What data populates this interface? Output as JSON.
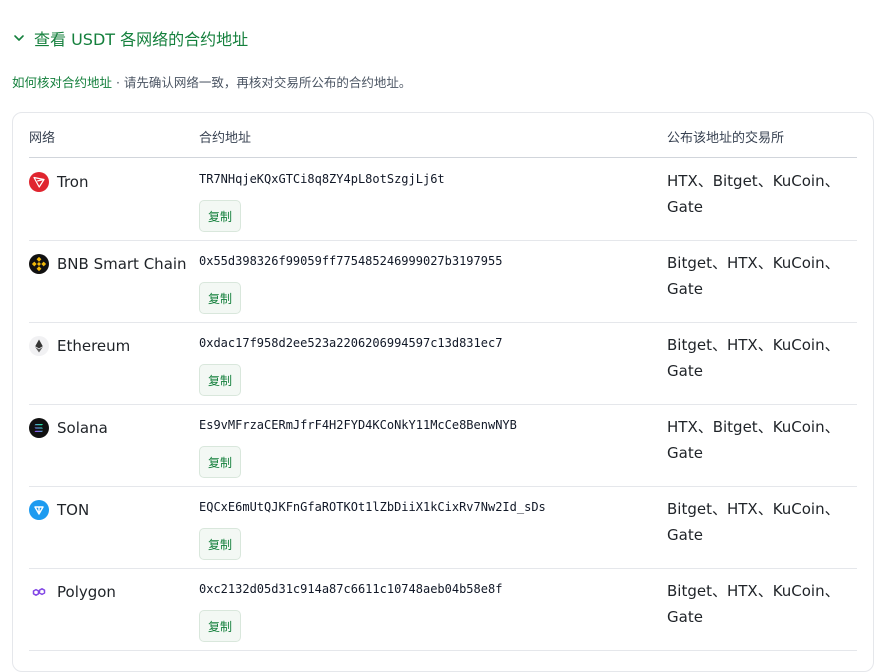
{
  "header": {
    "toggle_label": "查看 USDT 各网络的合约地址",
    "hint_link": "如何核对合约地址",
    "hint_text": " · 请先确认网络一致，再核对交易所公布的合约地址。"
  },
  "table": {
    "col_network": "网络",
    "col_address": "合约地址",
    "col_exchanges": "公布该地址的交易所",
    "copy_label": "复制",
    "rows": [
      {
        "network": "Tron",
        "icon": "tron-icon",
        "address": "TR7NHqjeKQxGTCi8q8ZY4pL8otSzgjLj6t",
        "exchanges": "HTX、Bitget、KuCoin、Gate"
      },
      {
        "network": "BNB Smart Chain",
        "icon": "bnb-icon",
        "address": "0x55d398326f99059ff775485246999027b3197955",
        "exchanges": "Bitget、HTX、KuCoin、Gate"
      },
      {
        "network": "Ethereum",
        "icon": "ethereum-icon",
        "address": "0xdac17f958d2ee523a2206206994597c13d831ec7",
        "exchanges": "Bitget、HTX、KuCoin、Gate"
      },
      {
        "network": "Solana",
        "icon": "solana-icon",
        "address": "Es9vMFrzaCERmJfrF4H2FYD4KCoNkY11McCe8BenwNYB",
        "exchanges": "HTX、Bitget、KuCoin、Gate"
      },
      {
        "network": "TON",
        "icon": "ton-icon",
        "address": "EQCxE6mUtQJKFnGfaROTKOt1lZbDiiX1kCixRv7Nw2Id_sDs",
        "exchanges": "Bitget、HTX、KuCoin、Gate"
      },
      {
        "network": "Polygon",
        "icon": "polygon-icon",
        "address": "0xc2132d05d31c914a87c6611c10748aeb04b58e8f",
        "exchanges": "Bitget、HTX、KuCoin、Gate"
      }
    ]
  },
  "colors": {
    "accent": "#15803d",
    "tron": "#e0252f",
    "bnb": "#f0b90b",
    "ton": "#1d9bf0",
    "polygon": "#8247e5"
  }
}
